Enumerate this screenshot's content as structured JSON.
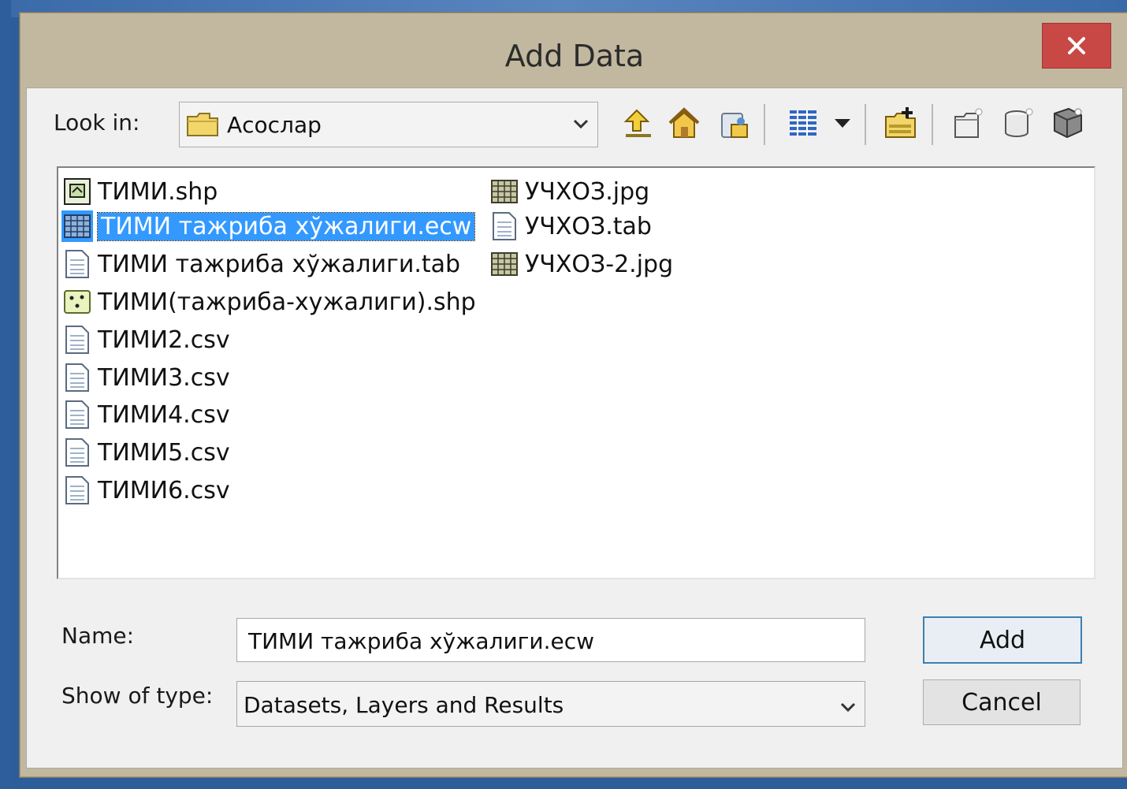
{
  "dialog": {
    "title": "Add Data",
    "close_label": "×"
  },
  "look_in": {
    "label": "Look in:",
    "value": "Асослар"
  },
  "toolbar": {
    "icons": [
      "up-one-level-icon",
      "home-icon",
      "connect-to-folder-icon",
      "view-options-icon",
      "new-folder-icon",
      "new-shapefile-icon",
      "new-geodatabase-icon",
      "new-file-gdb-icon"
    ]
  },
  "files_col1": [
    {
      "name": "ТИМИ.shp",
      "icon": "polygon-shapefile-icon"
    },
    {
      "name": "ТИМИ тажриба хўжалиги.ecw",
      "icon": "raster-icon",
      "selected": true
    },
    {
      "name": "ТИМИ тажриба хўжалиги.tab",
      "icon": "table-file-icon"
    },
    {
      "name": "ТИМИ(тажриба-хужалиги).shp",
      "icon": "point-shapefile-icon"
    },
    {
      "name": "ТИМИ2.csv",
      "icon": "table-file-icon"
    },
    {
      "name": "ТИМИ3.csv",
      "icon": "table-file-icon"
    },
    {
      "name": "ТИМИ4.csv",
      "icon": "table-file-icon"
    },
    {
      "name": "ТИМИ5.csv",
      "icon": "table-file-icon"
    },
    {
      "name": "ТИМИ6.csv",
      "icon": "table-file-icon"
    }
  ],
  "files_col2": [
    {
      "name": "УЧХОЗ.jpg",
      "icon": "raster-icon"
    },
    {
      "name": "УЧХОЗ.tab",
      "icon": "table-file-icon"
    },
    {
      "name": "УЧХОЗ-2.jpg",
      "icon": "raster-icon"
    }
  ],
  "name_field": {
    "label": "Name:",
    "value": "ТИМИ тажриба хўжалиги.ecw"
  },
  "type_field": {
    "label": "Show of type:",
    "value": "Datasets, Layers and Results"
  },
  "buttons": {
    "add": "Add",
    "cancel": "Cancel"
  }
}
